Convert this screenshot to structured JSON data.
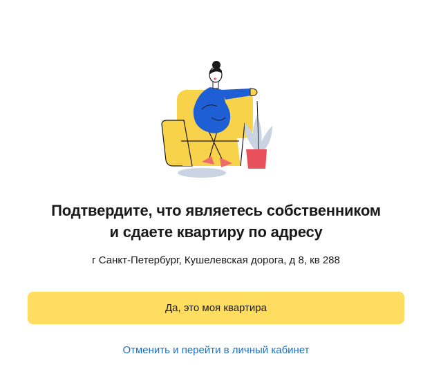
{
  "dialog": {
    "illustration": "woman-sitting-in-armchair-illustration",
    "title_line1": "Подтвердите, что являетесь собственником",
    "title_line2": "и сдаете квартиру по адресу",
    "address": "г Санкт-Петербург, Кушелевская дорога, д 8, кв 288",
    "confirm_label": "Да, это моя квартира",
    "cancel_label": "Отменить и перейти в личный кабинет"
  },
  "colors": {
    "accent_button": "#ffdd60",
    "link": "#1a6fc7",
    "armchair": "#f8d24a",
    "dress": "#1f5fd6",
    "pot": "#e8505b",
    "plant": "#c9d3e2"
  }
}
